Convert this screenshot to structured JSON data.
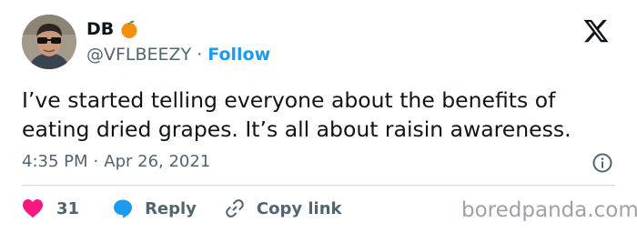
{
  "author": {
    "display_name": "DB",
    "badge_icon": "orange-emoji-icon",
    "handle": "@VFLBEEZY",
    "separator": "·",
    "follow_label": "Follow"
  },
  "tweet": {
    "lines": [
      "I’ve started telling everyone about the benefits of",
      "eating dried grapes. It’s all about raisin awareness."
    ]
  },
  "meta": {
    "time": "4:35 PM",
    "separator": "·",
    "date": "Apr 26, 2021"
  },
  "actions": {
    "like_count": "31",
    "reply_label": "Reply",
    "copy_label": "Copy link"
  },
  "watermark": "boredpanda.com",
  "colors": {
    "accent": "#1d9bf0",
    "like": "#f91880",
    "text": "#0f1419",
    "secondary": "#536471",
    "divider": "#cfd9de"
  },
  "icons": [
    "x-logo-icon",
    "info-icon",
    "heart-icon",
    "reply-bubble-icon",
    "link-icon"
  ]
}
